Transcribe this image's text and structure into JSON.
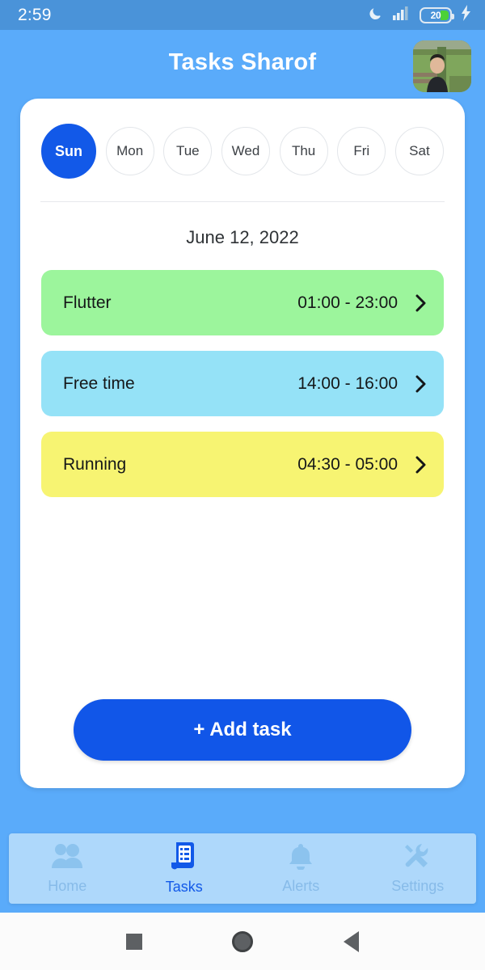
{
  "status_bar": {
    "time": "2:59",
    "battery_percent": "20",
    "icons": [
      "moon-icon",
      "signal-bars-icon",
      "battery-icon",
      "charging-bolt-icon"
    ]
  },
  "app_bar": {
    "title": "Tasks Sharof",
    "avatar_alt": "user-profile-photo"
  },
  "day_selector": {
    "days": [
      {
        "label": "Sun",
        "selected": true
      },
      {
        "label": "Mon",
        "selected": false
      },
      {
        "label": "Tue",
        "selected": false
      },
      {
        "label": "Wed",
        "selected": false
      },
      {
        "label": "Thu",
        "selected": false
      },
      {
        "label": "Fri",
        "selected": false
      },
      {
        "label": "Sat",
        "selected": false
      }
    ]
  },
  "date_label": "June 12, 2022",
  "tasks": [
    {
      "title": "Flutter",
      "time": "01:00 - 23:00",
      "color": "#9cf59c"
    },
    {
      "title": "Free time",
      "time": "14:00 - 16:00",
      "color": "#95e2f7"
    },
    {
      "title": "Running",
      "time": "04:30 - 05:00",
      "color": "#f7f472"
    }
  ],
  "add_button": {
    "label": "+ Add task"
  },
  "bottom_nav": {
    "items": [
      {
        "label": "Home",
        "icon": "people-icon",
        "active": false
      },
      {
        "label": "Tasks",
        "icon": "list-doc-icon",
        "active": true
      },
      {
        "label": "Alerts",
        "icon": "bell-icon",
        "active": false
      },
      {
        "label": "Settings",
        "icon": "tools-icon",
        "active": false
      }
    ]
  },
  "system_nav": {
    "recents": "recents-square-button",
    "home": "home-circle-button",
    "back": "back-triangle-button"
  },
  "colors": {
    "background": "#5aabfa",
    "status_bar": "#4a93d9",
    "accent": "#1259e8",
    "card": "#ffffff",
    "nav_bar": "#aed8fb"
  }
}
